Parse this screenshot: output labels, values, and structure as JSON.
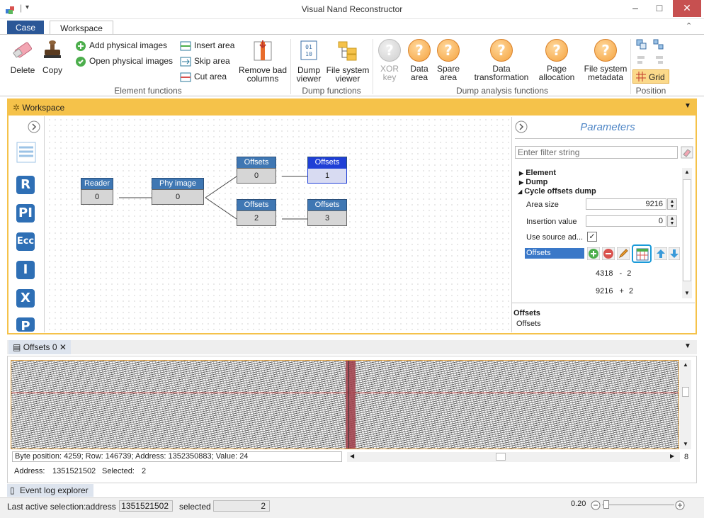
{
  "window": {
    "title": "Visual Nand Reconstructor"
  },
  "ribbon_tabs": {
    "case": "Case",
    "workspace": "Workspace"
  },
  "ribbon": {
    "delete": "Delete",
    "copy": "Copy",
    "add_physical_images": "Add physical images",
    "open_physical_images": "Open physical images",
    "insert_area": "Insert area",
    "skip_area": "Skip area",
    "cut_area": "Cut area",
    "remove_bad_columns_1": "Remove bad",
    "remove_bad_columns_2": "columns",
    "element_functions": "Element functions",
    "dump_viewer_1": "Dump",
    "dump_viewer_2": "viewer",
    "file_system_viewer_1": "File system",
    "file_system_viewer_2": "viewer",
    "dump_functions": "Dump functions",
    "xor_key_1": "XOR",
    "xor_key_2": "key",
    "data_area_1": "Data",
    "data_area_2": "area",
    "spare_area_1": "Spare",
    "spare_area_2": "area",
    "data_transformation_1": "Data",
    "data_transformation_2": "transformation",
    "page_allocation_1": "Page",
    "page_allocation_2": "allocation",
    "file_system_metadata_1": "File system",
    "file_system_metadata_2": "metadata",
    "dump_analysis_functions": "Dump analysis functions",
    "grid": "Grid",
    "position": "Position"
  },
  "workspace_tab": {
    "label": "Workspace"
  },
  "left_tools": [
    "R",
    "PI",
    "Ecc",
    "I",
    "X",
    "P"
  ],
  "nodes": {
    "reader": {
      "title": "Reader",
      "value": "0"
    },
    "phy": {
      "title": "Phy image",
      "value": "0"
    },
    "off0": {
      "title": "Offsets",
      "value": "0"
    },
    "off1": {
      "title": "Offsets",
      "value": "1"
    },
    "off2": {
      "title": "Offsets",
      "value": "2"
    },
    "off3": {
      "title": "Offsets",
      "value": "3"
    }
  },
  "parameters": {
    "title": "Parameters",
    "filter_placeholder": "Enter filter string",
    "element": "Element",
    "dump": "Dump",
    "cycle_offsets_dump": "Cycle offsets dump",
    "area_size_label": "Area size",
    "area_size_value": "9216",
    "insertion_value_label": "Insertion value",
    "insertion_value_value": "0",
    "use_source_label": "Use source ad...",
    "offsets_label": "Offsets",
    "offset_rows": [
      {
        "a": "4318",
        "op": "-",
        "b": "2"
      },
      {
        "a": "9216",
        "op": "+",
        "b": "2"
      }
    ],
    "desc_title": "Offsets",
    "desc_text": "Offsets"
  },
  "dump_tab": {
    "label": "Offsets 0"
  },
  "dump_info": {
    "status_line": "Byte position: 4259; Row: 146739; Address: 1352350883; Value: 24",
    "address_label": "Address:",
    "address_value": "1351521502",
    "selected_label": "Selected:",
    "selected_value": "2",
    "hscroll_end": "8"
  },
  "event_log": {
    "label": "Event log explorer"
  },
  "statusbar": {
    "last_active": "Last active selection:",
    "address_label": "address",
    "address_value": "1351521502",
    "selected_label": "selected",
    "selected_value": "2",
    "zoom": "0.20"
  },
  "colors": {
    "accent_blue": "#2b5797",
    "node_blue": "#3f77b3",
    "frame_orange": "#f5c24a",
    "selected_node": "#1f3fd6"
  }
}
